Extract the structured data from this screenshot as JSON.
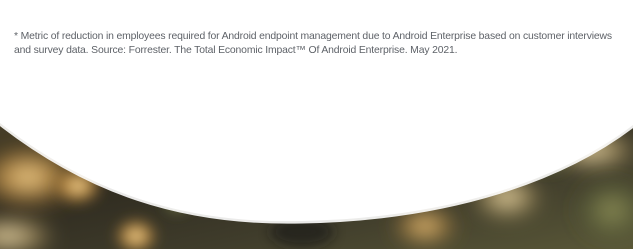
{
  "footnote": {
    "text": "* Metric of reduction in employees required for Android endpoint management due to Android Enterprise based on customer interviews and survey data. Source: Forrester. The Total Economic Impact™ Of Android Enterprise. May 2021."
  },
  "background": {
    "page_color": "#ffffff",
    "bokeh_dark": "#3b3525",
    "bokeh_warm": "#c79b4a",
    "bokeh_light": "#f7e3aa",
    "bokeh_green": "#556b3f"
  }
}
